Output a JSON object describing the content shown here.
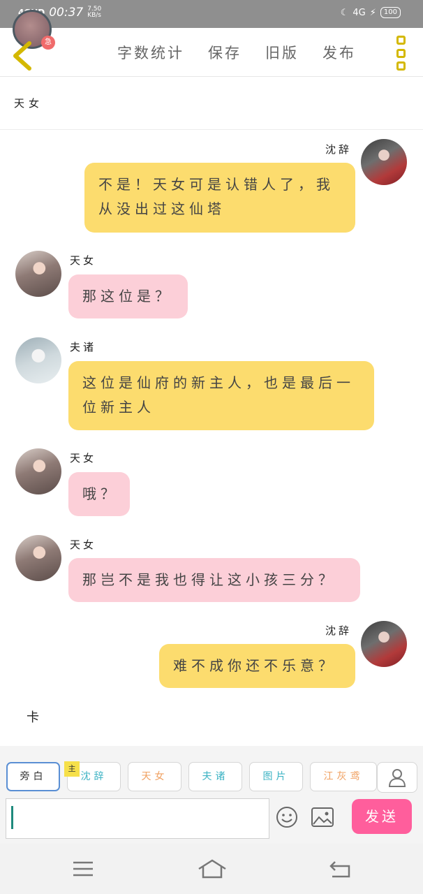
{
  "status_bar": {
    "network": "4GHD",
    "time": "00:37",
    "speed_top": "7.50",
    "speed_bottom": "KB/s",
    "right_network": "4G",
    "battery": "100"
  },
  "toolbar": {
    "back_badge": "急",
    "menu": [
      "字数统计",
      "保存",
      "旧版",
      "发布"
    ]
  },
  "chapter_title": "天女",
  "messages": [
    {
      "side": "right",
      "speaker": "沈辞",
      "avatar": "shen-ci-avatar",
      "bubble_color": "#fcdc6e",
      "text": "不是！天女可是认错人了，我从没出过这仙塔"
    },
    {
      "side": "left",
      "speaker": "天女",
      "avatar": "tian-nv-avatar",
      "bubble_color": "#fccfd8",
      "text": "那这位是？"
    },
    {
      "side": "left",
      "speaker": "夫诸",
      "avatar": "fu-zhu-avatar",
      "bubble_color": "#fcdc6e",
      "text": "这位是仙府的新主人，也是最后一位新主人"
    },
    {
      "side": "left",
      "speaker": "天女",
      "avatar": "tian-nv-avatar",
      "bubble_color": "#fccfd8",
      "text": "哦？"
    },
    {
      "side": "left",
      "speaker": "天女",
      "avatar": "tian-nv-avatar",
      "bubble_color": "#fccfd8",
      "text": "那岂不是我也得让这小孩三分？"
    },
    {
      "side": "right",
      "speaker": "沈辞",
      "avatar": "shen-ci-avatar",
      "bubble_color": "#fcdc6e",
      "text": "难不成你还不乐意？"
    }
  ],
  "narration": "卡",
  "characters": {
    "main_tag": "主",
    "items": [
      {
        "label": "旁白",
        "color": "#333333"
      },
      {
        "label": "沈辞",
        "color": "#3db3c4"
      },
      {
        "label": "天女",
        "color": "#f0a060"
      },
      {
        "label": "夫诸",
        "color": "#3db3c4"
      },
      {
        "label": "图片",
        "color": "#3db3c4"
      },
      {
        "label": "江灰鸢",
        "color": "#f0a060"
      }
    ]
  },
  "input": {
    "value": "",
    "placeholder": ""
  },
  "send_label": "发送",
  "colors": {
    "status_bar": "#8f8f8f",
    "yellow_bubble": "#fcdc6e",
    "pink_bubble": "#fccfd8",
    "send_button": "#ff5e9c",
    "more_icon": "#d4b800",
    "back_icon": "#d4b800"
  }
}
